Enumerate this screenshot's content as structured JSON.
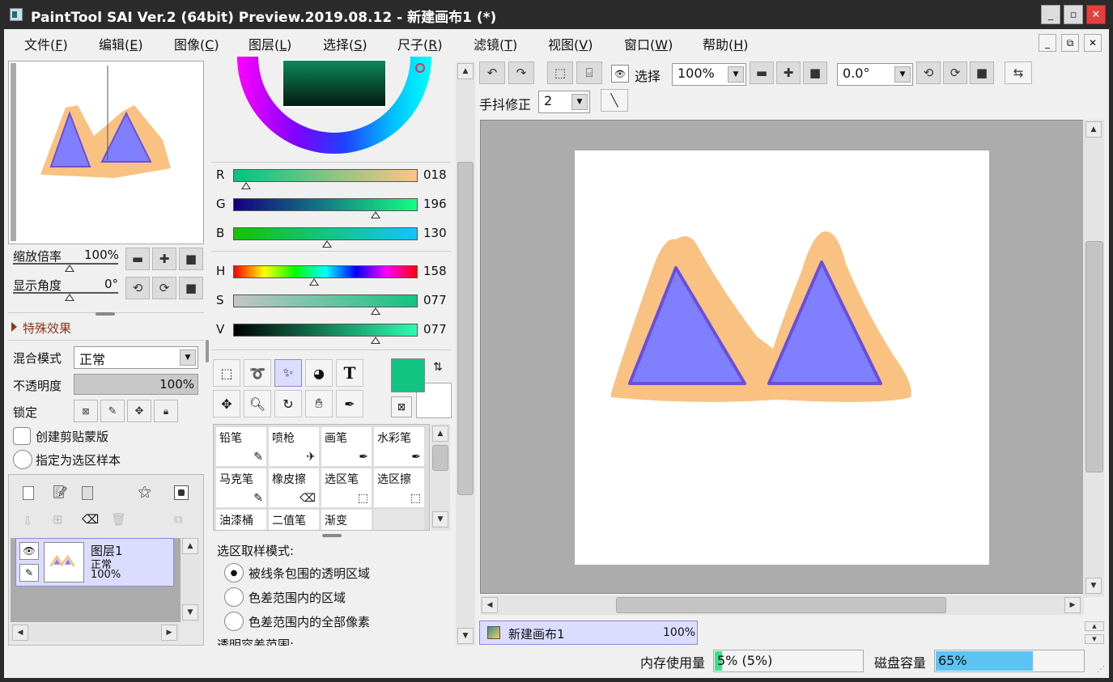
{
  "window": {
    "title": "PaintTool SAI Ver.2 (64bit) Preview.2019.08.12 - 新建画布1 (*)"
  },
  "menu": [
    {
      "label": "文件(",
      "key": "F",
      "end": ")"
    },
    {
      "label": "编辑(",
      "key": "E",
      "end": ")"
    },
    {
      "label": "图像(",
      "key": "C",
      "end": ")"
    },
    {
      "label": "图层(",
      "key": "L",
      "end": ")"
    },
    {
      "label": "选择(",
      "key": "S",
      "end": ")"
    },
    {
      "label": "尺子(",
      "key": "R",
      "end": ")"
    },
    {
      "label": "滤镜(",
      "key": "T",
      "end": ")"
    },
    {
      "label": "视图(",
      "key": "V",
      "end": ")"
    },
    {
      "label": "窗口(",
      "key": "W",
      "end": ")"
    },
    {
      "label": "帮助(",
      "key": "H",
      "end": ")"
    }
  ],
  "navigator": {
    "zoom_label": "缩放倍率",
    "zoom_value": "100%",
    "angle_label": "显示角度",
    "angle_value": "0°"
  },
  "effects": {
    "label": "特殊效果"
  },
  "layer_props": {
    "blend_label": "混合模式",
    "blend_value": "正常",
    "opacity_label": "不透明度",
    "opacity_value": "100%",
    "lock_label": "锁定",
    "clip_label": "创建剪贴蒙版",
    "sample_label": "指定为选区样本"
  },
  "layers": [
    {
      "name": "图层1",
      "mode": "正常",
      "opacity": "100%"
    }
  ],
  "color": {
    "current": "#12c482",
    "secondary": "#ffffff",
    "rgb": [
      {
        "label": "R",
        "value": "018",
        "fraction": 0.07
      },
      {
        "label": "G",
        "value": "196",
        "fraction": 0.77
      },
      {
        "label": "B",
        "value": "130",
        "fraction": 0.51
      }
    ],
    "hsv": [
      {
        "label": "H",
        "value": "158",
        "fraction": 0.44
      },
      {
        "label": "S",
        "value": "077",
        "fraction": 0.77
      },
      {
        "label": "V",
        "value": "077",
        "fraction": 0.77
      }
    ]
  },
  "brushes": [
    {
      "name": "铅笔"
    },
    {
      "name": "喷枪"
    },
    {
      "name": "画笔"
    },
    {
      "name": "水彩笔"
    },
    {
      "name": "马克笔"
    },
    {
      "name": "橡皮擦"
    },
    {
      "name": "选区笔"
    },
    {
      "name": "选区擦"
    },
    {
      "name": "油漆桶"
    },
    {
      "name": "二值笔"
    },
    {
      "name": "渐变"
    }
  ],
  "selection": {
    "title": "选区取样模式:",
    "options": [
      "被线条包围的透明区域",
      "色差范围内的区域",
      "色差范围内的全部像素"
    ],
    "selected_index": 0,
    "trailing": "透明容差范围:"
  },
  "toolbar": {
    "select_label": "选择",
    "zoom_value": "100%",
    "angle_value": "0.0°",
    "stabilizer_label": "手抖修正",
    "stabilizer_value": "2"
  },
  "document_tab": {
    "name": "新建画布1",
    "zoom": "100%"
  },
  "status": {
    "memory_label": "内存使用量",
    "memory_value": "5% (5%)",
    "memory_fraction": 0.05,
    "disk_label": "磁盘容量",
    "disk_value": "65%",
    "disk_fraction": 0.65
  },
  "colors": {
    "peach": "#f9c182",
    "purple_fill": "#8080ff",
    "purple_edge": "#6a50d8",
    "canvas_bg": "#acacac",
    "disk_bar": "#5bc4f5",
    "mem_bar": "#3ee08a"
  }
}
